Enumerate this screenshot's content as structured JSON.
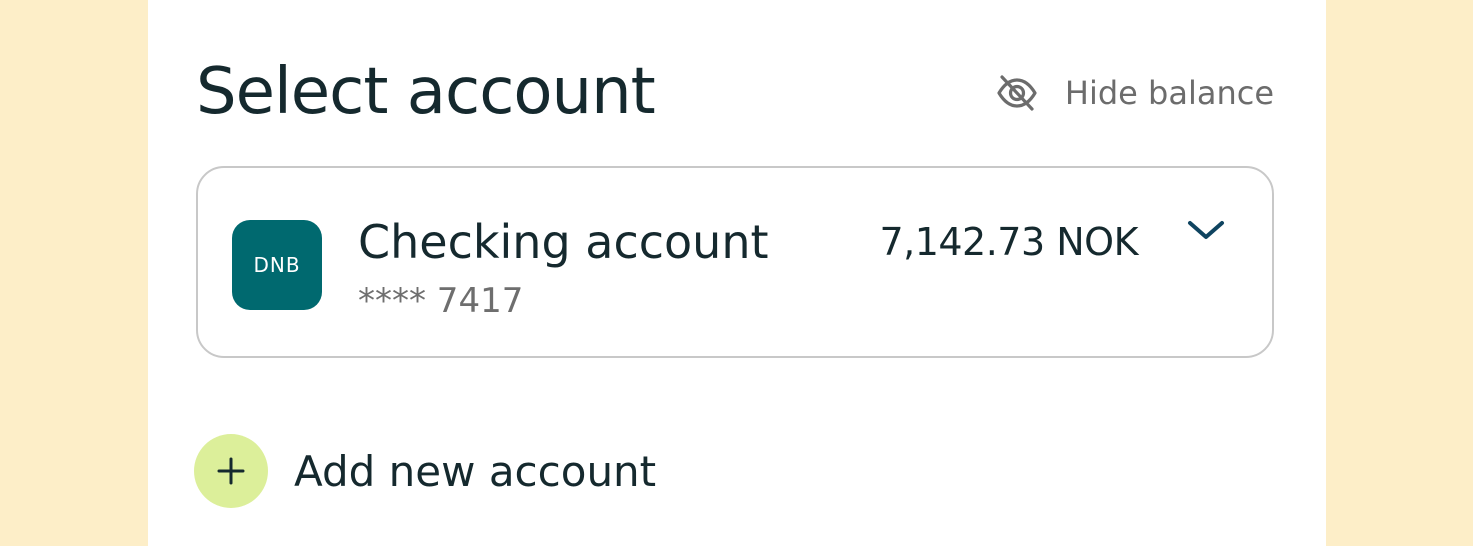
{
  "header": {
    "title": "Select account",
    "hide_balance_label": "Hide balance",
    "hide_balance_icon": "eye-off-icon"
  },
  "account": {
    "logo_text": "DNB",
    "name": "Checking account",
    "masked_number": "**** 7417",
    "balance": "7,142.73 NOK",
    "expand_icon": "chevron-down-icon"
  },
  "add_account": {
    "icon": "plus-icon",
    "label": "Add new account"
  },
  "colors": {
    "page_background": "#fdeec8",
    "panel_background": "#ffffff",
    "text_primary": "#15292e",
    "text_secondary": "#6e6e6e",
    "logo_background": "#00696f",
    "add_circle": "#dcef9a",
    "chevron": "#0f4460"
  }
}
